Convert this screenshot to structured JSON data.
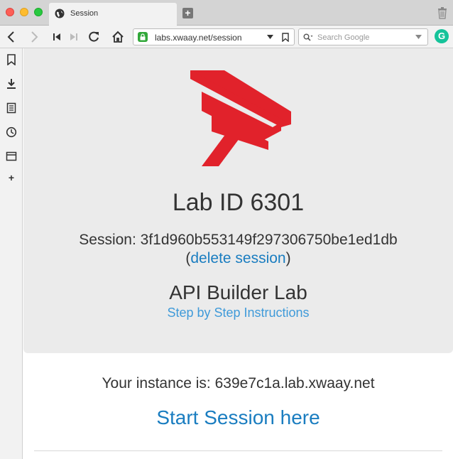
{
  "browser": {
    "tab_title": "Session",
    "new_tab_label": "+",
    "url": "labs.xwaay.net/session",
    "search_placeholder": "Search Google",
    "grammarly_label": "G"
  },
  "icons": {
    "sidebar": [
      "bookmark-icon",
      "download-icon",
      "notes-icon",
      "history-icon",
      "window-icon",
      "add-panel-icon"
    ],
    "add_panel_label": "+"
  },
  "colors": {
    "logo_red": "#e1222b",
    "link_blue": "#1a7dc0",
    "instructions_blue": "#3f9ad9",
    "panel_gray": "#ebebeb"
  },
  "page": {
    "lab_id": "Lab ID 6301",
    "session_prefix": "Session: 3f1d960b553149f297306750be1ed1db",
    "delete_open": "(",
    "delete_link": "delete session",
    "delete_close": ")",
    "lab_name": "API Builder Lab",
    "instructions_link": "Step by Step Instructions",
    "instance_text": "Your instance is: 639e7c1a.lab.xwaay.net",
    "start_link": "Start Session here"
  }
}
